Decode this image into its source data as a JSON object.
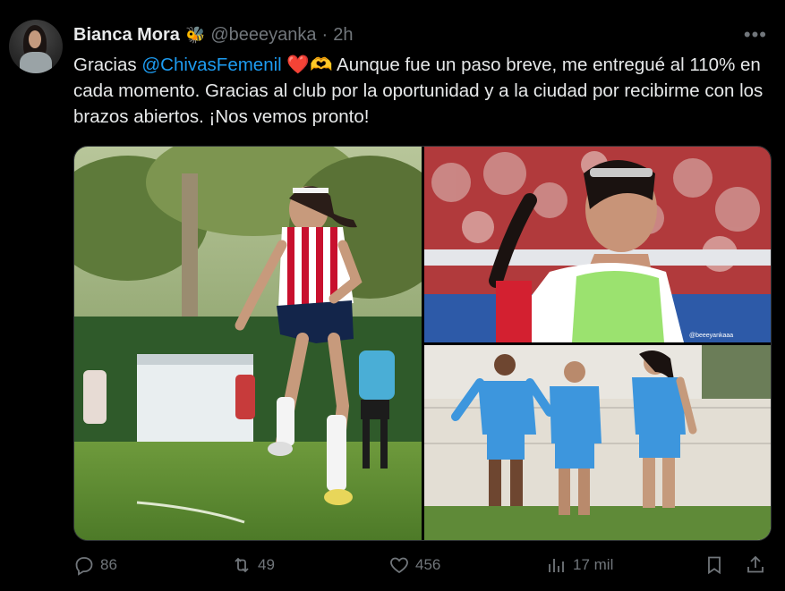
{
  "author": {
    "name": "Bianca Mora",
    "badge_emoji": "🐝",
    "handle": "@beeeyanka",
    "separator": "·",
    "time": "2h"
  },
  "more_icon": "more-horizontal-icon",
  "text": {
    "part1": "Gracias ",
    "mention": "@ChivasFemenil",
    "emoji_heart": "❤️",
    "emoji_hands": "🫶",
    "part2": " Aunque fue un paso breve, me entregué al 110% en cada momento. Gracias al club por la oportunidad y a la ciudad por recibirme con los brazos abiertos. ¡Nos vemos pronto!"
  },
  "media": {
    "watermark": "@beeeyankaaa"
  },
  "actions": {
    "replies": "86",
    "reposts": "49",
    "likes": "456",
    "views": "17 mil"
  },
  "colors": {
    "background": "#000000",
    "text": "#e7e9ea",
    "muted": "#71767b",
    "link": "#1d9bf0"
  }
}
